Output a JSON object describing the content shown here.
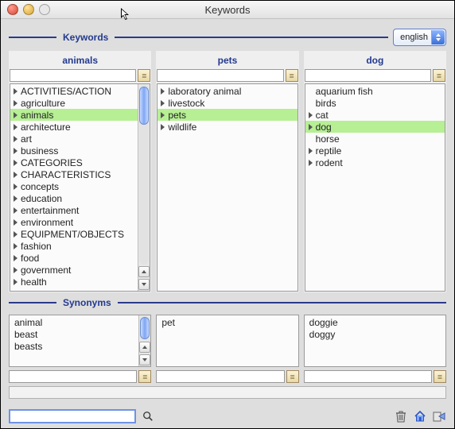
{
  "window": {
    "title": "Keywords"
  },
  "section": {
    "main_label": "Keywords",
    "synonyms_label": "Synonyms"
  },
  "language": {
    "selected": "english"
  },
  "columns": [
    {
      "header": "animals",
      "search_value": "",
      "selected_index": 2,
      "items": [
        {
          "label": "ACTIVITIES/ACTION",
          "expandable": true
        },
        {
          "label": "agriculture",
          "expandable": true
        },
        {
          "label": "animals",
          "expandable": true
        },
        {
          "label": "architecture",
          "expandable": true
        },
        {
          "label": "art",
          "expandable": true
        },
        {
          "label": "business",
          "expandable": true
        },
        {
          "label": "CATEGORIES",
          "expandable": true
        },
        {
          "label": "CHARACTERISTICS",
          "expandable": true
        },
        {
          "label": "concepts",
          "expandable": true
        },
        {
          "label": "education",
          "expandable": true
        },
        {
          "label": "entertainment",
          "expandable": true
        },
        {
          "label": "environment",
          "expandable": true
        },
        {
          "label": "EQUIPMENT/OBJECTS",
          "expandable": true
        },
        {
          "label": "fashion",
          "expandable": true
        },
        {
          "label": "food",
          "expandable": true
        },
        {
          "label": "government",
          "expandable": true
        },
        {
          "label": "health",
          "expandable": true
        }
      ],
      "synonyms": [
        "animal",
        "beast",
        "beasts"
      ],
      "bottom_search_value": ""
    },
    {
      "header": "pets",
      "search_value": "",
      "selected_index": 2,
      "items": [
        {
          "label": "laboratory animal",
          "expandable": true
        },
        {
          "label": "livestock",
          "expandable": true
        },
        {
          "label": "pets",
          "expandable": true
        },
        {
          "label": "wildlife",
          "expandable": true
        }
      ],
      "synonyms": [
        "pet"
      ],
      "bottom_search_value": ""
    },
    {
      "header": "dog",
      "search_value": "",
      "selected_index": 3,
      "items": [
        {
          "label": "aquarium fish",
          "expandable": false
        },
        {
          "label": "birds",
          "expandable": false
        },
        {
          "label": "cat",
          "expandable": true
        },
        {
          "label": "dog",
          "expandable": true
        },
        {
          "label": "horse",
          "expandable": false
        },
        {
          "label": "reptile",
          "expandable": true
        },
        {
          "label": "rodent",
          "expandable": true
        }
      ],
      "synonyms": [
        "doggie",
        "doggy"
      ],
      "bottom_search_value": ""
    }
  ],
  "footer": {
    "search_value": ""
  },
  "icons": {
    "column_button": "keyword-list-icon",
    "search": "search-icon",
    "trash": "trash-icon",
    "home": "home-icon",
    "apply": "apply-icon"
  }
}
